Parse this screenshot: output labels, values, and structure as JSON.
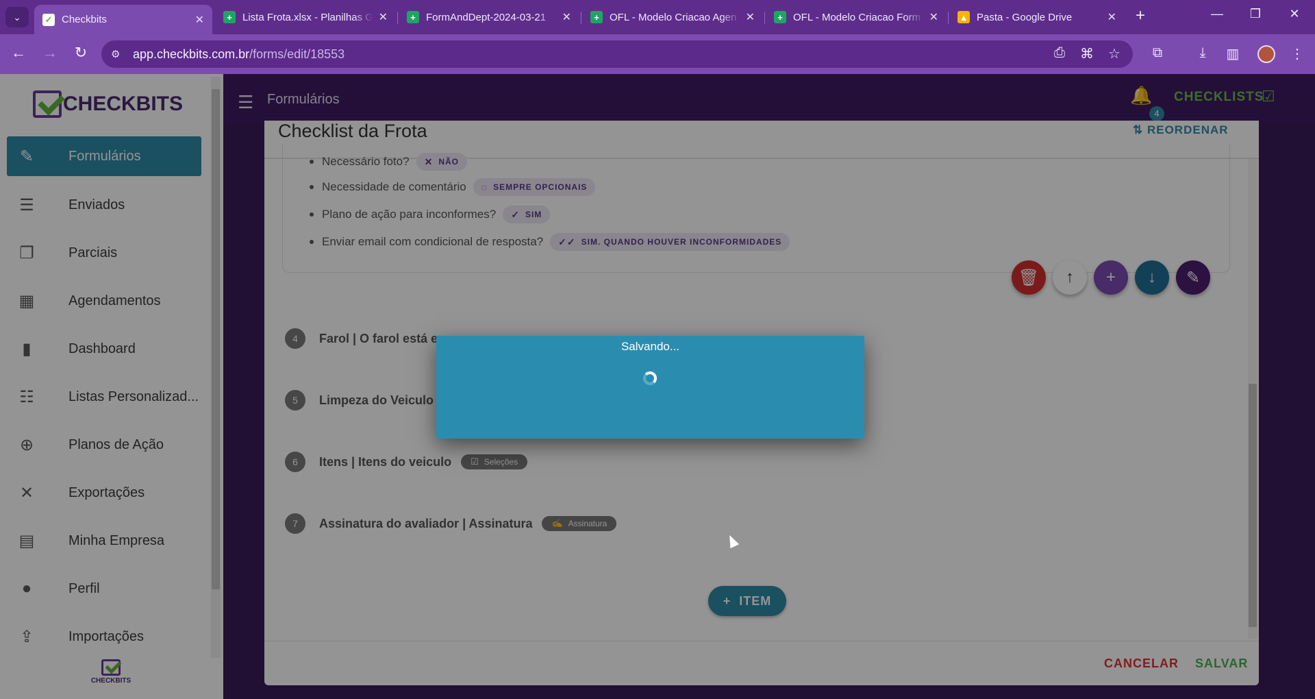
{
  "browser": {
    "tabs": [
      {
        "title": "Checkbits",
        "active": true,
        "icon": "checkbits-favicon"
      },
      {
        "title": "Lista Frota.xlsx - Planilhas G",
        "icon": "sheets-icon"
      },
      {
        "title": "FormAndDept-2024-03-21",
        "icon": "sheets-icon"
      },
      {
        "title": "OFL - Modelo Criacao Agen",
        "icon": "sheets-icon"
      },
      {
        "title": "OFL - Modelo Criacao Form",
        "icon": "sheets-icon"
      },
      {
        "title": "Pasta - Google Drive",
        "icon": "drive-icon"
      }
    ],
    "url_host": "app.checkbits.com.br",
    "url_path": "/forms/edit/18553"
  },
  "sidebar": {
    "logo_text": "CHECKBITS",
    "items": [
      {
        "label": "Formulários",
        "icon": "forms-icon",
        "active": true
      },
      {
        "label": "Enviados",
        "icon": "sent-icon"
      },
      {
        "label": "Parciais",
        "icon": "partial-icon"
      },
      {
        "label": "Agendamentos",
        "icon": "calendar-icon"
      },
      {
        "label": "Dashboard",
        "icon": "bar-chart-icon"
      },
      {
        "label": "Listas Personalizad...",
        "icon": "database-icon"
      },
      {
        "label": "Planos de Ação",
        "icon": "target-icon"
      },
      {
        "label": "Exportações",
        "icon": "excel-icon"
      },
      {
        "label": "Minha Empresa",
        "icon": "building-icon"
      },
      {
        "label": "Perfil",
        "icon": "person-icon"
      },
      {
        "label": "Importações",
        "icon": "import-icon"
      }
    ],
    "mini_logo_text": "CHECKBITS"
  },
  "header": {
    "title": "Formulários",
    "notification_count": "4",
    "checklists_label": "CHECKLISTS"
  },
  "form": {
    "title": "Checklist da Frota",
    "reorder_label": "REORDENAR",
    "properties": [
      {
        "label": "Necessário foto?",
        "value": "NÃO"
      },
      {
        "label": "Necessidade de comentário",
        "value": "SEMPRE OPCIONAIS"
      },
      {
        "label": "Plano de ação para inconformes?",
        "value": "SIM"
      },
      {
        "label": "Enviar email com condicional de resposta?",
        "value": "SIM. QUANDO HOUVER INCONFORMIDADES"
      }
    ],
    "questions": [
      {
        "num": "4",
        "text": "Farol | O farol está em..."
      },
      {
        "num": "5",
        "text": "Limpeza do Veiculo |"
      },
      {
        "num": "6",
        "text": "Itens | Itens do veiculo",
        "tag": "Seleções"
      },
      {
        "num": "7",
        "text": "Assinatura do avaliador | Assinatura",
        "tag": "Assinatura"
      }
    ],
    "add_item_label": "ITEM",
    "cancel_label": "CANCELAR",
    "save_label": "SALVAR"
  },
  "dialog": {
    "title": "Salvando..."
  },
  "colors": {
    "browser_chrome": "#7c4bb0",
    "app_bar": "#3f1b63",
    "accent": "#2e8aa6",
    "brand_green": "#68c040",
    "danger": "#d33"
  }
}
